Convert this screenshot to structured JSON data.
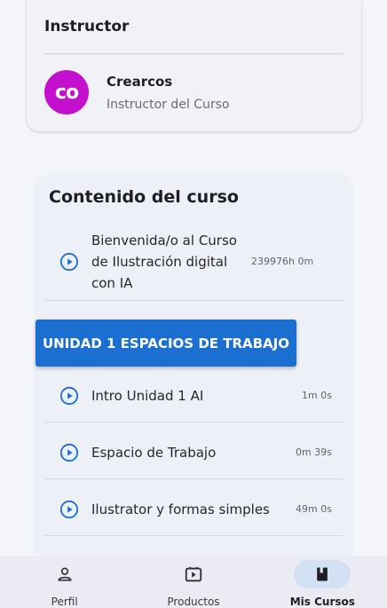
{
  "instructor": {
    "heading": "Instructor",
    "avatar_text": "co",
    "name": "Crearcos",
    "role": "Instructor del Curso"
  },
  "content": {
    "title": "Contenido del curso",
    "lessons_top": [
      {
        "title": "Bienvenida/o al Curso de Ilustración digital con IA",
        "duration": "239976h 0m"
      }
    ],
    "unit": {
      "label": "UNIDAD 1 ESPACIOS DE TRABAJO"
    },
    "lessons_unit": [
      {
        "title": "Intro Unidad 1 AI",
        "duration": "1m 0s"
      },
      {
        "title": "Espacio de Trabajo",
        "duration": "0m 39s"
      },
      {
        "title": "Ilustrator y formas simples",
        "duration": "49m 0s"
      }
    ]
  },
  "nav": {
    "items": [
      {
        "label": "Perfil",
        "icon": "person-icon",
        "active": false
      },
      {
        "label": "Productos",
        "icon": "video-icon",
        "active": false
      },
      {
        "label": "Mis Cursos",
        "icon": "book-icon",
        "active": true
      }
    ]
  },
  "colors": {
    "accent": "#1b6fd1",
    "avatar": "#c40fcf"
  }
}
